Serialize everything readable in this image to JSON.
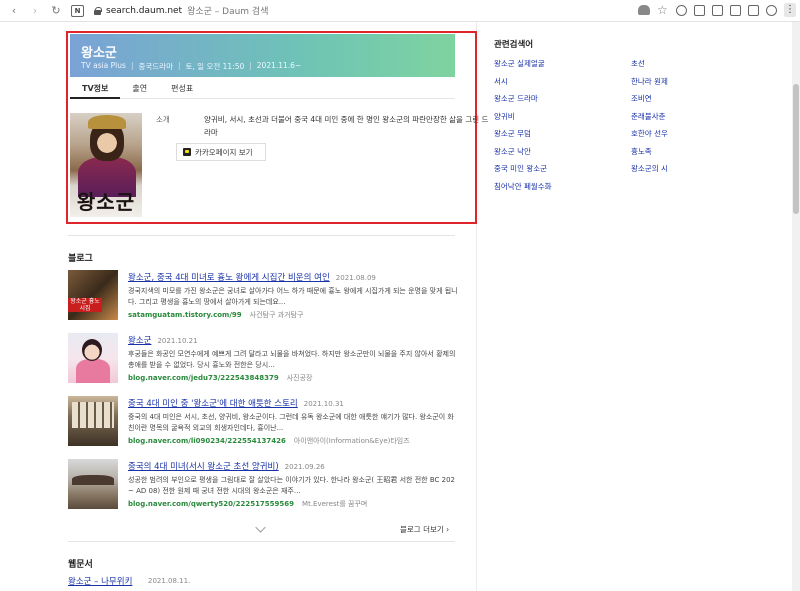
{
  "browser": {
    "url_host": "search.daum.net",
    "page_title": "왕소군 – Daum 검색"
  },
  "infobox": {
    "title": "왕소군",
    "meta": [
      "TV asia Plus",
      "중국드라마",
      "토, 일 오전 11:50",
      "2021.11.6~"
    ],
    "tabs": [
      "TV정보",
      "출연",
      "편성표"
    ],
    "poster_text": "왕소군",
    "desc_label": "소개",
    "description": "양귀비, 서시, 초선과 더불어 중국 4대 미인 중에 한 명인 왕소군의 파란만장한 삶을 그린 드라마",
    "kakao_button": "카카오페이지 보기"
  },
  "blog": {
    "section_title": "블로그",
    "posts": [
      {
        "title_pre": "왕소군, 중국 4대 미녀로 흉노 왕에게 시집간 비운의 여인",
        "date": "2021.08.09",
        "body": "경국지색의 미모를 가진 왕소군은 궁녀로 살아가다 어느 하가 때문에 흉노 왕에게 시집가게 되는 운명을 맞게 됩니다. 그리고 평생을 흉노의 땅에서 살아가게 되는데요...",
        "source": "satamguatam.tistory.com/99",
        "source_extra": "사건탐구 과거탐구",
        "thumb_text": "왕소군 흉노 시집"
      },
      {
        "title_pre": "왕소군",
        "date": "2021.10.21",
        "body": "후궁들은 화공인 모연수에게 예쁘게 그려 달라고 뇌물을 바쳐었다. 하지만 왕소군만이 뇌물을 주지 않아서 황제의 총애를 받을 수 없었다.  당시 흉노와 전한은 당시...",
        "source": "blog.naver.com/jedu73/222543848379",
        "source_extra": "사진공장"
      },
      {
        "title_pre": "중국 4대 미인 중 '왕소군'에 대한 애틋한 스토리",
        "date": "2021.10.31",
        "body": "중국의 4대 미인은 서시, 초선, 양귀비, 왕소군이다. 그런데 유독 왕소군에 대한 애틋한 얘기가 많다. 왕소군이 화친이란 명목의 굴욕적 외교의 희생자인데다, 흉이난...",
        "source": "blog.naver.com/li090234/222554137426",
        "source_extra": "아이앤아이(Information&Eye)타임즈"
      },
      {
        "title_pre": "중국의 4대 미녀(서시 왕소군 초선 양귀비)",
        "date": "2021.09.26",
        "body": "성공한 범려의 부인으로 평생을 그림대로 잘 살았다는 이야기가 있다. 한나라 왕소군( 王昭君 서한 전한 BC 202 ~ AD 08) 전한 원제 때 궁녀 전한 시대의 왕소군은 재주...",
        "source": "blog.naver.com/qwerty520/222517559569",
        "source_extra": "Mt.Everest를 꿈꾸며"
      }
    ],
    "more_label": "블로그 더보기 ›"
  },
  "web": {
    "section_title": "웹문서",
    "link": "왕소군 – 나무위키",
    "date": "2021.08.11."
  },
  "related": {
    "title": "관련검색어",
    "col1": [
      "왕소군 실제얼굴",
      "서시",
      "왕소군 드라마",
      "양귀비",
      "왕소군 무덤",
      "왕소군 낙안",
      "중국 미인 왕소군",
      "침어낙안 폐월수화"
    ],
    "col2": [
      "초선",
      "한나라 원제",
      "조비연",
      "춘래불사춘",
      "호한야 선우",
      "흉노족",
      "왕소군의 시"
    ]
  },
  "colors": {
    "accent_red": "#e0242c",
    "link": "#1932a8",
    "source_green": "#2a8a3c"
  }
}
